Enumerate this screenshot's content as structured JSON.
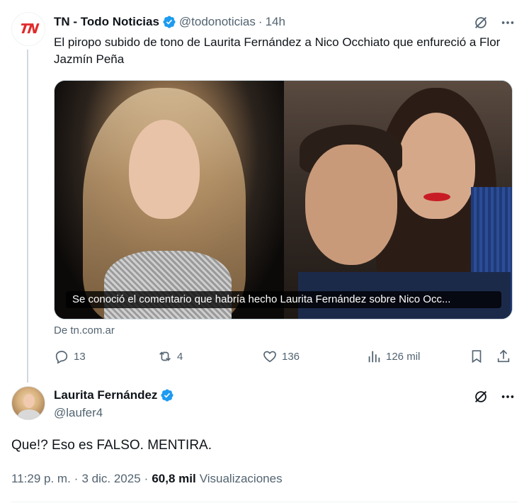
{
  "tweet": {
    "author_name": "TN - Todo Noticias",
    "avatar_logo": "TN",
    "handle": "@todonoticias",
    "separator": "·",
    "time": "14h",
    "text": "El piropo subido de tono de Laurita Fernández a Nico Occhiato que enfureció a Flor Jazmín Peña",
    "card_caption": "Se conoció el comentario que habría hecho Laurita Fernández sobre Nico Occ...",
    "source": "De tn.com.ar",
    "stats": {
      "replies": "13",
      "reposts": "4",
      "likes": "136",
      "views": "126 mil"
    }
  },
  "reply": {
    "author_name": "Laurita Fernández",
    "handle": "@laufer4",
    "text": "Que!? Eso es FALSO. MENTIRA.",
    "time": "11:29 p. m.",
    "date_separator": "·",
    "date": "3 dic. 2025",
    "views_separator": "·",
    "views_count": "60,8 mil",
    "views_label": "Visualizaciones"
  },
  "colors": {
    "verified_blue": "#1d9bf0",
    "secondary_text": "#536471",
    "primary_text": "#0f1419",
    "tn_red": "#e02b2b"
  },
  "icons": {
    "verified": "verified-badge-icon",
    "grok": "grok-icon",
    "more": "more-dots-icon",
    "reply": "reply-bubble-icon",
    "repost": "repost-icon",
    "like": "heart-icon",
    "views": "views-bars-icon",
    "bookmark": "bookmark-icon",
    "share": "share-icon"
  }
}
